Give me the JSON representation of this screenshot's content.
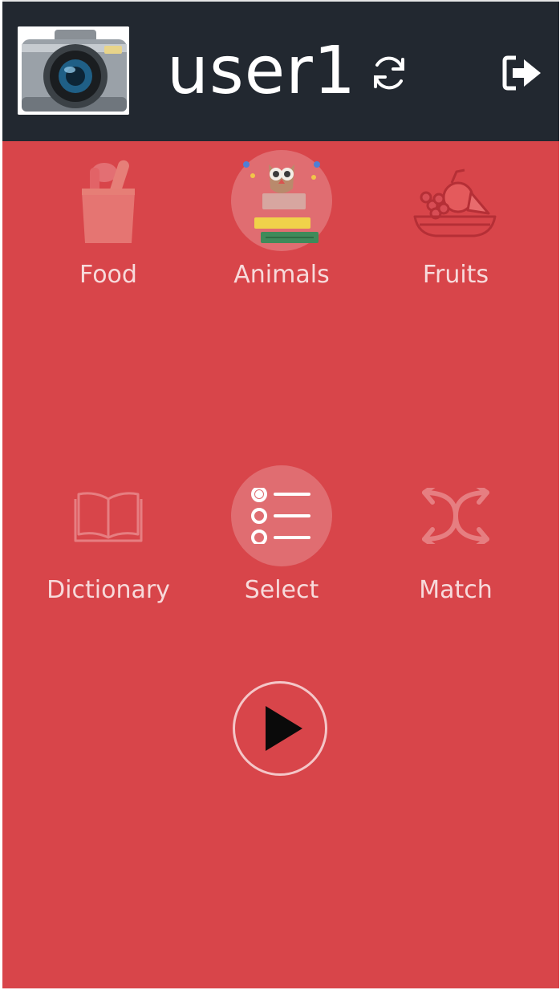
{
  "header": {
    "username": "user1",
    "avatar_icon": "camera-icon",
    "refresh_icon": "refresh-icon",
    "logout_icon": "logout-icon"
  },
  "categories": [
    {
      "label": "Food",
      "icon": "grocery-bag-icon",
      "selected": false
    },
    {
      "label": "Animals",
      "icon": "owl-books-icon",
      "selected": true
    },
    {
      "label": "Fruits",
      "icon": "fruit-bowl-icon",
      "selected": false
    }
  ],
  "modes": [
    {
      "label": "Dictionary",
      "icon": "open-book-icon",
      "selected": false
    },
    {
      "label": "Select",
      "icon": "radio-list-icon",
      "selected": true
    },
    {
      "label": "Match",
      "icon": "shuffle-icon",
      "selected": false
    }
  ],
  "actions": {
    "play_icon": "play-icon"
  },
  "colors": {
    "background": "#d8454a",
    "header": "#222830",
    "label": "#f7dadb"
  }
}
